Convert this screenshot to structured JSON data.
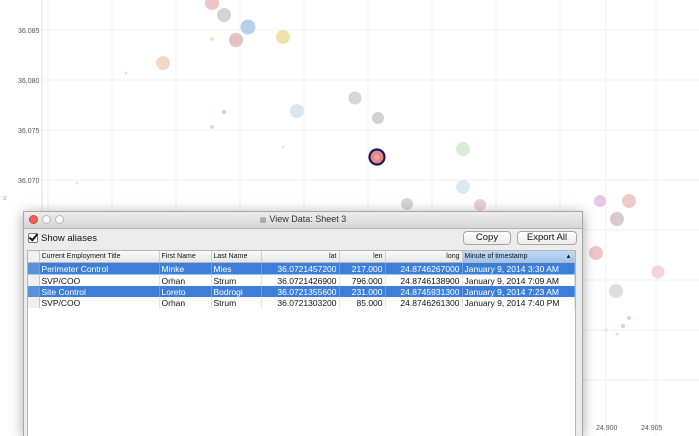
{
  "plot": {
    "y_ticks": [
      "36.085",
      "36.080",
      "36.075",
      "36.070"
    ],
    "x_ticks": [
      "24.900",
      "24.905"
    ],
    "left_edge_glyph": "ιu"
  },
  "window": {
    "title": "View Data:  Sheet 3",
    "title_icon": "grid-icon",
    "show_aliases_label": "Show aliases",
    "show_aliases_checked": true,
    "copy_label": "Copy",
    "export_label": "Export All",
    "sorted_indicator": "▲"
  },
  "table": {
    "columns": [
      "Current Employment Title",
      "First Name",
      "Last Name",
      "lat",
      "len",
      "long",
      "Minute of timestamp"
    ],
    "rows": [
      {
        "selected": true,
        "cells": [
          "Perimeter Control",
          "Minke",
          "Mies",
          "36.0721457200",
          "217.000",
          "24.8746267000",
          "January 9, 2014 3:30 AM"
        ]
      },
      {
        "selected": false,
        "cells": [
          "SVP/COO",
          "Orhan",
          "Strum",
          "36.0721426900",
          "796.000",
          "24.8746138900",
          "January 9, 2014 7:09 AM"
        ]
      },
      {
        "selected": true,
        "cells": [
          "Site Control",
          "Loreto",
          "Bodrogi",
          "36.0721355600",
          "231.000",
          "24.8745931300",
          "January 9, 2014 7:23 AM"
        ]
      },
      {
        "selected": false,
        "cells": [
          "SVP/COO",
          "Orhan",
          "Strum",
          "36.0721303200",
          "85.000",
          "24.8746261300",
          "January 9, 2014 7:40 PM"
        ]
      }
    ]
  },
  "colors": {
    "selection": "#3d7ed8",
    "highlight_marker": "#e6839a",
    "close_button": "#f4625a"
  }
}
